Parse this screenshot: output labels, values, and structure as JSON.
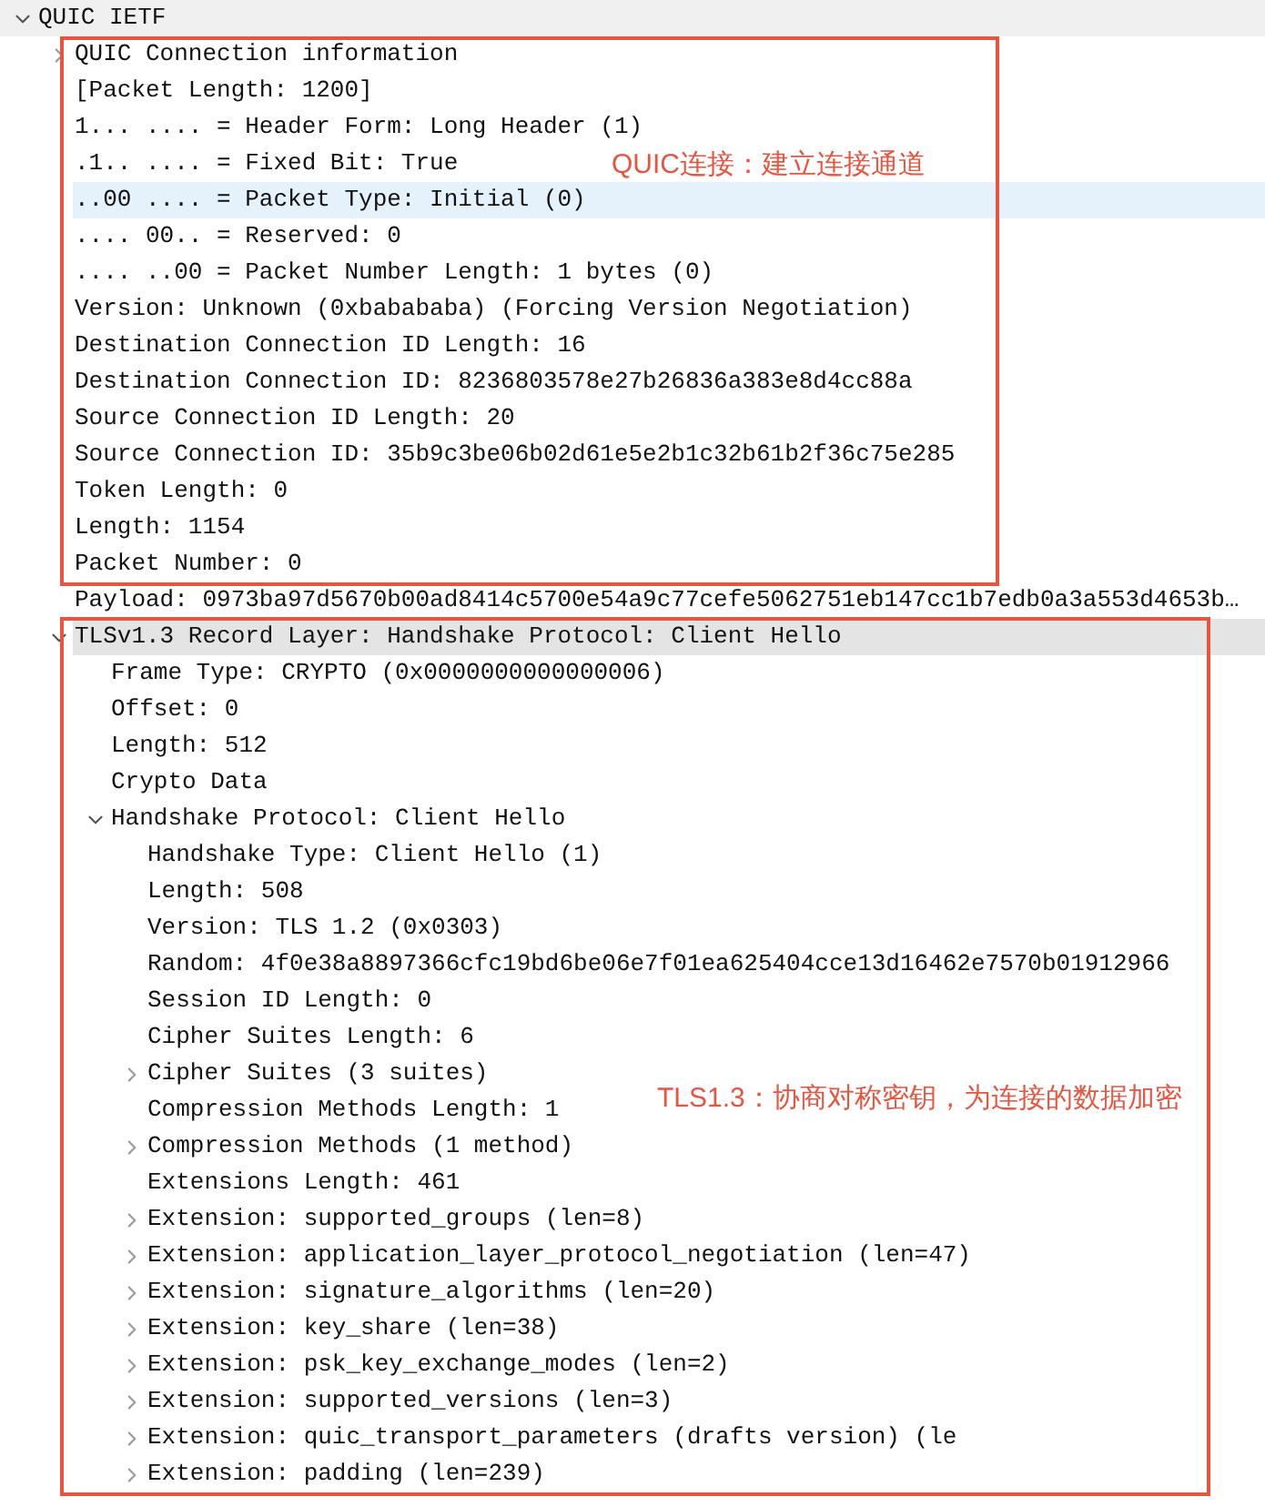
{
  "tree": [
    {
      "label": "QUIC IETF",
      "shaded": true,
      "expanded": true,
      "children": [
        {
          "label": "QUIC Connection information",
          "shaded": false,
          "selected": false,
          "expanded": false
        },
        {
          "label": "[Packet Length: 1200]",
          "shaded": false,
          "selected": false
        },
        {
          "label": "1... .... = Header Form: Long Header (1)",
          "shaded": false,
          "selected": false
        },
        {
          "label": ".1.. .... = Fixed Bit: True",
          "shaded": false,
          "selected": false
        },
        {
          "label": "..00 .... = Packet Type: Initial (0)",
          "shaded": false,
          "selected": true
        },
        {
          "label": ".... 00.. = Reserved: 0",
          "shaded": false,
          "selected": false
        },
        {
          "label": ".... ..00 = Packet Number Length: 1 bytes (0)",
          "shaded": false,
          "selected": false
        },
        {
          "label": "Version: Unknown (0xbabababa) (Forcing Version Negotiation)",
          "shaded": false,
          "selected": false
        },
        {
          "label": "Destination Connection ID Length: 16",
          "shaded": false,
          "selected": false
        },
        {
          "label": "Destination Connection ID: 8236803578e27b26836a383e8d4cc88a",
          "shaded": false,
          "selected": false
        },
        {
          "label": "Source Connection ID Length: 20",
          "shaded": false,
          "selected": false
        },
        {
          "label": "Source Connection ID: 35b9c3be06b02d61e5e2b1c32b61b2f36c75e285",
          "shaded": false,
          "selected": false
        },
        {
          "label": "Token Length: 0",
          "shaded": false,
          "selected": false
        },
        {
          "label": "Length: 1154",
          "shaded": false,
          "selected": false
        },
        {
          "label": "Packet Number: 0",
          "shaded": false,
          "selected": false
        },
        {
          "label": "Payload: 0973ba97d5670b00ad8414c5700e54a9c77cefe5062751eb147cc1b7edb0a3a553d4653b…",
          "shaded": false,
          "selected": false
        },
        {
          "label": "TLSv1.3 Record Layer: Handshake Protocol: Client Hello",
          "shaded": true,
          "selected": false,
          "expanded": true,
          "children": [
            {
              "label": "Frame Type: CRYPTO (0x0000000000000006)",
              "shaded": false,
              "selected": false
            },
            {
              "label": "Offset: 0",
              "shaded": false,
              "selected": false
            },
            {
              "label": "Length: 512",
              "shaded": false,
              "selected": false
            },
            {
              "label": "Crypto Data",
              "shaded": false,
              "selected": false
            },
            {
              "label": "Handshake Protocol: Client Hello",
              "shaded": false,
              "selected": false,
              "expanded": true,
              "children": [
                {
                  "label": "Handshake Type: Client Hello (1)",
                  "shaded": false,
                  "selected": false
                },
                {
                  "label": "Length: 508",
                  "shaded": false,
                  "selected": false
                },
                {
                  "label": "Version: TLS 1.2 (0x0303)",
                  "shaded": false,
                  "selected": false
                },
                {
                  "label": "Random: 4f0e38a8897366cfc19bd6be06e7f01ea625404cce13d16462e7570b01912966",
                  "shaded": false,
                  "selected": false
                },
                {
                  "label": "Session ID Length: 0",
                  "shaded": false,
                  "selected": false
                },
                {
                  "label": "Cipher Suites Length: 6",
                  "shaded": false,
                  "selected": false
                },
                {
                  "label": "Cipher Suites (3 suites)",
                  "shaded": false,
                  "selected": false,
                  "expanded": false
                },
                {
                  "label": "Compression Methods Length: 1",
                  "shaded": false,
                  "selected": false
                },
                {
                  "label": "Compression Methods (1 method)",
                  "shaded": false,
                  "selected": false,
                  "expanded": false
                },
                {
                  "label": "Extensions Length: 461",
                  "shaded": false,
                  "selected": false
                },
                {
                  "label": "Extension: supported_groups (len=8)",
                  "shaded": false,
                  "selected": false,
                  "expanded": false
                },
                {
                  "label": "Extension: application_layer_protocol_negotiation (len=47)",
                  "shaded": false,
                  "selected": false,
                  "expanded": false
                },
                {
                  "label": "Extension: signature_algorithms (len=20)",
                  "shaded": false,
                  "selected": false,
                  "expanded": false
                },
                {
                  "label": "Extension: key_share (len=38)",
                  "shaded": false,
                  "selected": false,
                  "expanded": false
                },
                {
                  "label": "Extension: psk_key_exchange_modes (len=2)",
                  "shaded": false,
                  "selected": false,
                  "expanded": false
                },
                {
                  "label": "Extension: supported_versions (len=3)",
                  "shaded": false,
                  "selected": false,
                  "expanded": false
                },
                {
                  "label": "Extension: quic_transport_parameters (drafts version) (le",
                  "shaded": false,
                  "selected": false,
                  "expanded": false
                },
                {
                  "label": "Extension: padding (len=239)",
                  "shaded": false,
                  "selected": false,
                  "expanded": false
                }
              ]
            }
          ]
        }
      ]
    }
  ],
  "annotations": [
    {
      "text": "QUIC连接：建立连接通道"
    },
    {
      "text": "TLS1.3：协商对称密钥，为连接的数据加密"
    }
  ]
}
